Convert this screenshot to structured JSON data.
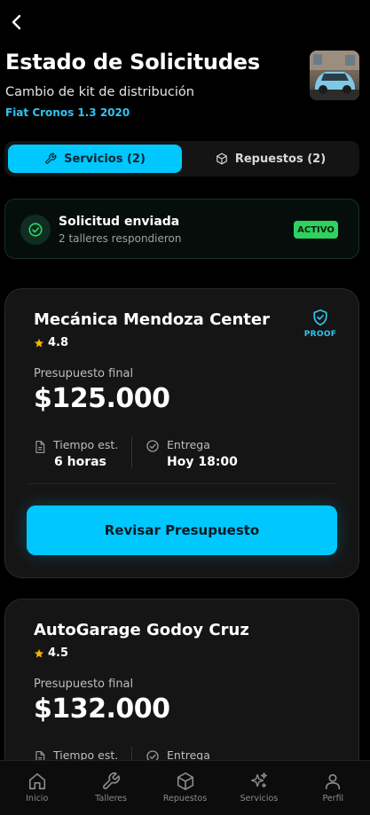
{
  "header": {
    "title": "Estado de Solicitudes",
    "subtitle": "Cambio de kit de distribución",
    "vehicle": "Fiat Cronos 1.3 2020"
  },
  "tabs": [
    {
      "label": "Servicios (2)",
      "icon": "wrench-icon",
      "active": true
    },
    {
      "label": "Repuestos (2)",
      "icon": "box-icon",
      "active": false
    }
  ],
  "status": {
    "title": "Solicitud enviada",
    "subtitle": "2 talleres respondieron",
    "badge": "ACTIVO"
  },
  "quotes": [
    {
      "name": "Mecánica Mendoza Center",
      "rating": "4.8",
      "proof": "PROOF",
      "budget_label": "Presupuesto final",
      "price": "$125.000",
      "time_label": "Tiempo est.",
      "time_value": "6 horas",
      "delivery_label": "Entrega",
      "delivery_value": "Hoy 18:00",
      "cta": "Revisar Presupuesto"
    },
    {
      "name": "AutoGarage Godoy Cruz",
      "rating": "4.5",
      "budget_label": "Presupuesto final",
      "price": "$132.000",
      "time_label": "Tiempo est.",
      "delivery_label": "Entrega"
    }
  ],
  "nav": [
    {
      "label": "Inicio",
      "icon": "home-icon"
    },
    {
      "label": "Talleres",
      "icon": "wrench-icon"
    },
    {
      "label": "Repuestos",
      "icon": "box-icon"
    },
    {
      "label": "Servicios",
      "icon": "sparkles-icon"
    },
    {
      "label": "Perfil",
      "icon": "user-icon"
    }
  ],
  "colors": {
    "accent": "#00c8ff",
    "active_badge": "#2ed25f",
    "star": "#f5b400"
  }
}
